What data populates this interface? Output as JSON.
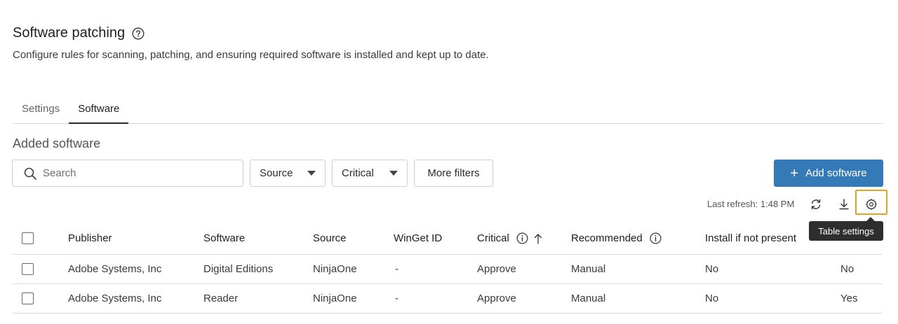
{
  "page": {
    "title": "Software patching",
    "description": "Configure rules for scanning, patching, and ensuring required software is installed and kept up to date."
  },
  "tabs": [
    {
      "label": "Settings",
      "active": false
    },
    {
      "label": "Software",
      "active": true
    }
  ],
  "section": {
    "title": "Added software"
  },
  "toolbar": {
    "search_placeholder": "Search",
    "source_label": "Source",
    "critical_label": "Critical",
    "more_filters_label": "More filters",
    "add_label": "Add software",
    "last_refresh": "Last refresh: 1:48 PM",
    "tooltip": "Table settings"
  },
  "table": {
    "columns": [
      "Publisher",
      "Software",
      "Source",
      "WinGet ID",
      "Critical",
      "Recommended",
      "Install if not present",
      ""
    ],
    "rows": [
      [
        "Adobe Systems, Inc",
        "Digital Editions",
        "NinjaOne",
        "-",
        "Approve",
        "Manual",
        "No",
        "No"
      ],
      [
        "Adobe Systems, Inc",
        "Reader",
        "NinjaOne",
        "-",
        "Approve",
        "Manual",
        "No",
        "Yes"
      ]
    ]
  },
  "colors": {
    "accent": "#337ab7",
    "highlight": "#e6a11e",
    "tooltip_bg": "#2e2e2e"
  }
}
